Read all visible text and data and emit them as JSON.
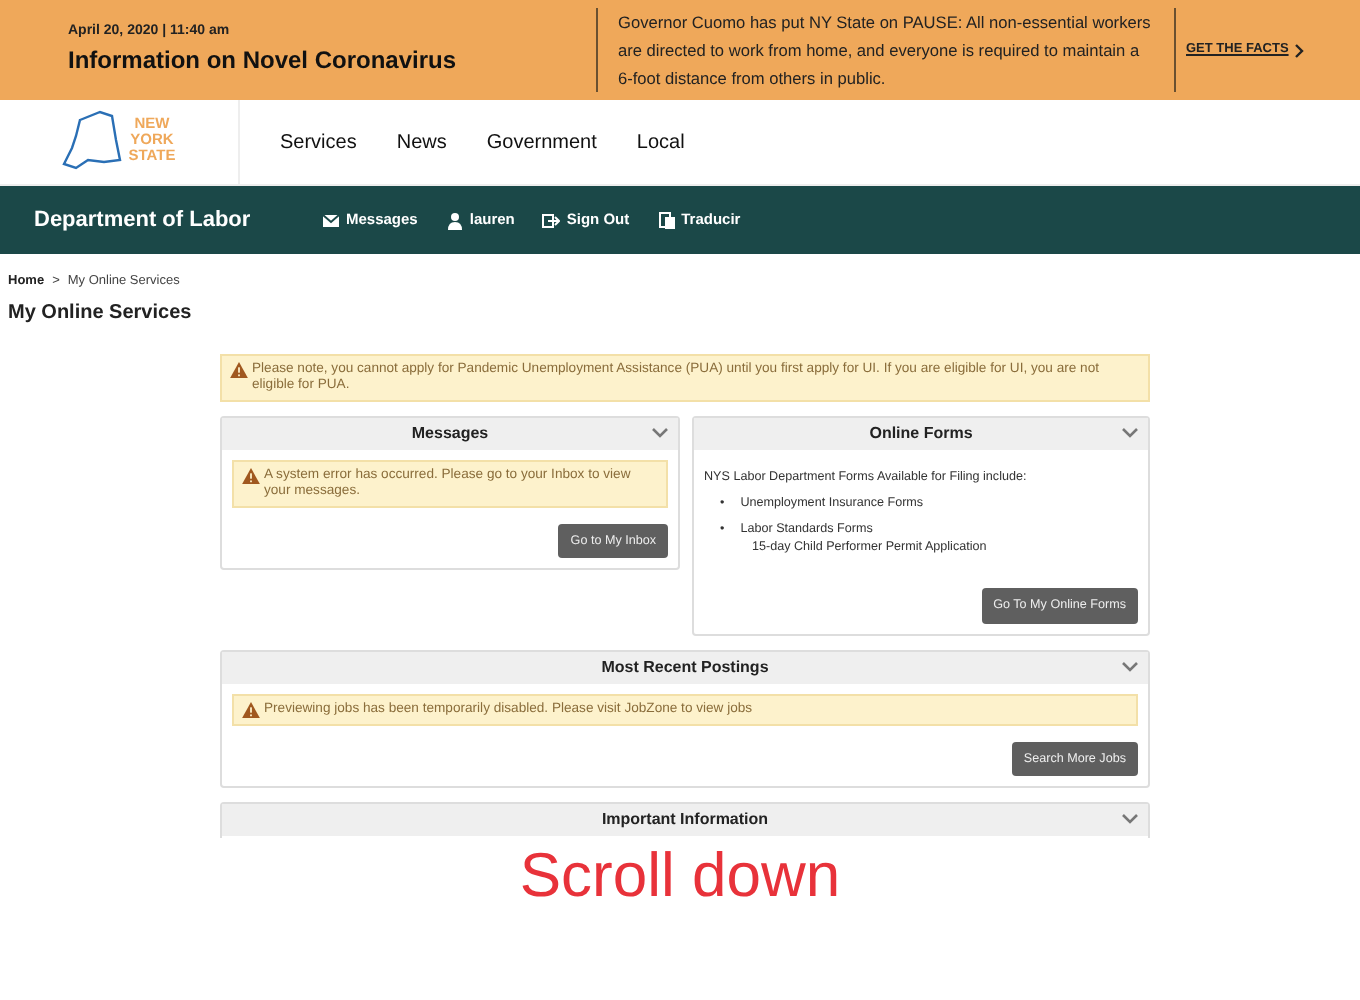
{
  "banner": {
    "date": "April 20, 2020",
    "separator": "|",
    "time": "11:40 am",
    "title": "Information on Novel Coronavirus",
    "message": "Governor Cuomo has put NY State on PAUSE: All non-essential workers are directed to work from home, and everyone is required to maintain a 6-foot distance from others in public.",
    "link": "GET THE FACTS"
  },
  "logo": {
    "lines": [
      "NEW",
      "YORK",
      "STATE"
    ]
  },
  "main_nav": [
    "Services",
    "News",
    "Government",
    "Local"
  ],
  "agency_bar": {
    "title": "Department of Labor",
    "links": [
      {
        "kind": "envelope",
        "label": "Messages"
      },
      {
        "kind": "user",
        "label": "lauren"
      },
      {
        "kind": "signout",
        "label": "Sign Out"
      },
      {
        "kind": "translate",
        "label": "Traducir"
      }
    ]
  },
  "breadcrumb": {
    "home": "Home",
    "separator": ">",
    "current": "My Online Services"
  },
  "page_title": "My Online Services",
  "notice": "Please note, you cannot apply for Pandemic Unemployment Assistance (PUA) until you first apply for UI. If you are eligible for UI, you are not eligible for PUA.",
  "panels": [
    {
      "title": "Messages",
      "kind": "alert",
      "alert": "A system error has occurred. Please go to your Inbox to view your messages.",
      "button": "Go to My Inbox"
    },
    {
      "title": "Online Forms",
      "kind": "list",
      "intro": "NYS Labor Department Forms Available for Filing include:",
      "items": [
        {
          "marker": "•",
          "label": "Unemployment Insurance Forms"
        },
        {
          "marker": "•",
          "label": "Labor Standards Forms",
          "sub": "15-day Child Performer Permit Application"
        }
      ],
      "button": "Go To My Online Forms"
    },
    {
      "title": "Most Recent Postings",
      "kind": "alert",
      "alert": "Previewing jobs has been temporarily disabled. Please visit JobZone to view jobs",
      "button": "Search More Jobs"
    },
    {
      "title": "Important Information",
      "kind": "header"
    }
  ],
  "annotation": "Scroll down"
}
